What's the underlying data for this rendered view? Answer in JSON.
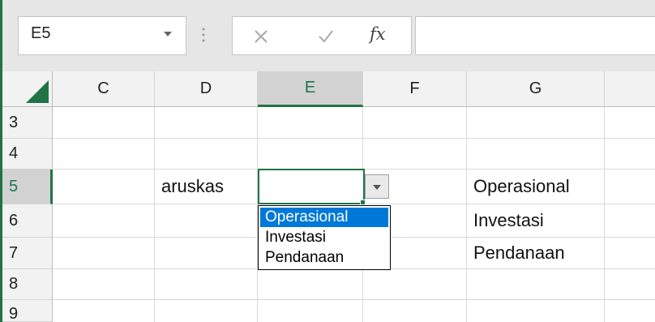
{
  "formula_bar": {
    "name_box": "E5",
    "fx_label": "fx",
    "formula_value": ""
  },
  "grid": {
    "columns": [
      "C",
      "D",
      "E",
      "F",
      "G"
    ],
    "rows": [
      "3",
      "4",
      "5",
      "6",
      "7",
      "8",
      "9"
    ],
    "selected_column": "E",
    "selected_row": "5",
    "cells": {
      "D5": "aruskas",
      "G5": "Operasional",
      "G6": "Investasi",
      "G7": "Pendanaan"
    }
  },
  "dropdown": {
    "options": [
      "Operasional",
      "Investasi",
      "Pendanaan"
    ],
    "highlighted": "Operasional"
  },
  "colors": {
    "accent": "#217346",
    "highlight": "#0078d7"
  }
}
